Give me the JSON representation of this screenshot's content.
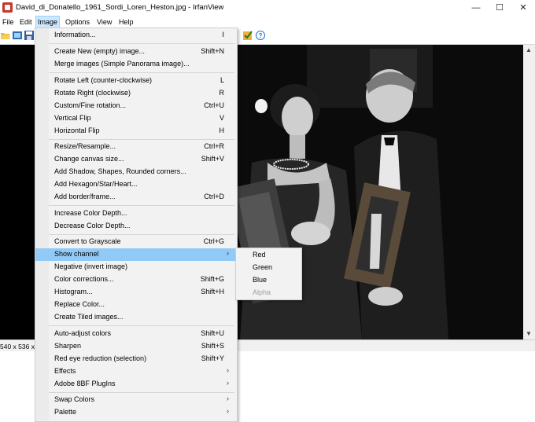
{
  "window": {
    "title": "David_di_Donatello_1961_Sordi_Loren_Heston.jpg - IrfanView",
    "minimize_glyph": "—",
    "maximize_glyph": "☐",
    "close_glyph": "✕"
  },
  "menubar": {
    "items": [
      "File",
      "Edit",
      "Image",
      "Options",
      "View",
      "Help"
    ]
  },
  "status": {
    "dimensions": "540 x 536 x 8"
  },
  "image_menu": {
    "items": [
      {
        "label": "Information...",
        "shortcut": "I"
      },
      {
        "label": "Create New (empty) image...",
        "shortcut": "Shift+N"
      },
      {
        "label": "Merge images (Simple Panorama image)...",
        "shortcut": ""
      },
      {
        "label": "Rotate Left (counter-clockwise)",
        "shortcut": "L"
      },
      {
        "label": "Rotate Right (clockwise)",
        "shortcut": "R"
      },
      {
        "label": "Custom/Fine rotation...",
        "shortcut": "Ctrl+U"
      },
      {
        "label": "Vertical Flip",
        "shortcut": "V"
      },
      {
        "label": "Horizontal Flip",
        "shortcut": "H"
      },
      {
        "label": "Resize/Resample...",
        "shortcut": "Ctrl+R"
      },
      {
        "label": "Change canvas size...",
        "shortcut": "Shift+V"
      },
      {
        "label": "Add Shadow, Shapes, Rounded corners...",
        "shortcut": ""
      },
      {
        "label": "Add Hexagon/Star/Heart...",
        "shortcut": ""
      },
      {
        "label": "Add border/frame...",
        "shortcut": "Ctrl+D"
      },
      {
        "label": "Increase Color Depth...",
        "shortcut": ""
      },
      {
        "label": "Decrease Color Depth...",
        "shortcut": ""
      },
      {
        "label": "Convert to Grayscale",
        "shortcut": "Ctrl+G"
      },
      {
        "label": "Show channel",
        "shortcut": ""
      },
      {
        "label": "Negative (invert image)",
        "shortcut": ""
      },
      {
        "label": "Color corrections...",
        "shortcut": "Shift+G"
      },
      {
        "label": "Histogram...",
        "shortcut": "Shift+H"
      },
      {
        "label": "Replace Color...",
        "shortcut": ""
      },
      {
        "label": "Create Tiled images...",
        "shortcut": ""
      },
      {
        "label": "Auto-adjust colors",
        "shortcut": "Shift+U"
      },
      {
        "label": "Sharpen",
        "shortcut": "Shift+S"
      },
      {
        "label": "Red eye reduction (selection)",
        "shortcut": "Shift+Y"
      },
      {
        "label": "Effects",
        "shortcut": ""
      },
      {
        "label": "Adobe 8BF PlugIns",
        "shortcut": ""
      },
      {
        "label": "Swap Colors",
        "shortcut": ""
      },
      {
        "label": "Palette",
        "shortcut": ""
      }
    ],
    "highlighted": "Show channel"
  },
  "channel_submenu": {
    "items": [
      {
        "label": "Red",
        "enabled": true
      },
      {
        "label": "Green",
        "enabled": true
      },
      {
        "label": "Blue",
        "enabled": true
      },
      {
        "label": "Alpha",
        "enabled": false
      }
    ]
  },
  "colors": {
    "highlight": "#91c9f7",
    "menu_bg": "#f2f2f2",
    "viewer_bg": "#000000"
  }
}
